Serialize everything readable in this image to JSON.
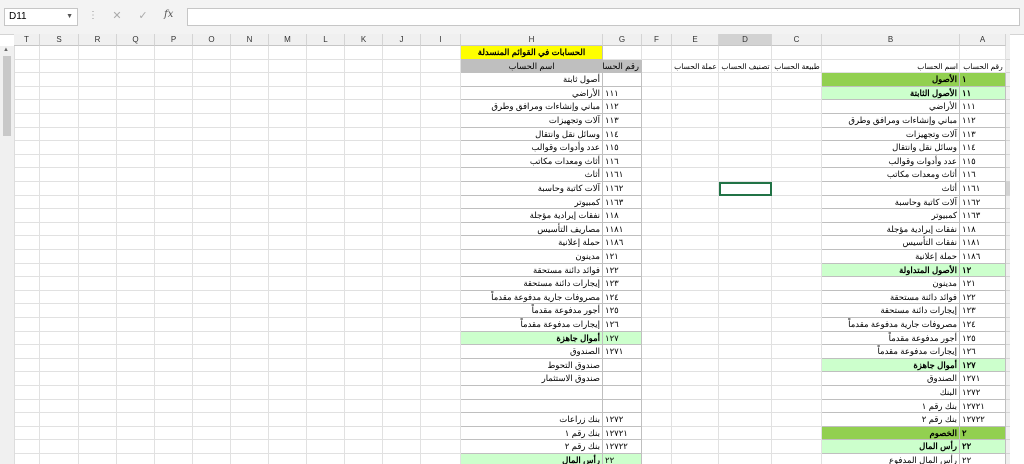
{
  "name_box": "D11",
  "formula_bar": {
    "cancel": "✕",
    "enter": "✓",
    "fx": "fx",
    "value": ""
  },
  "columns": [
    "T",
    "S",
    "R",
    "Q",
    "P",
    "O",
    "N",
    "M",
    "L",
    "K",
    "J",
    "I",
    "H",
    "G",
    "F",
    "E",
    "D",
    "C",
    "B",
    "A"
  ],
  "rows": [
    "1",
    "2",
    "3",
    "4",
    "5",
    "6",
    "7",
    "8",
    "9",
    "10",
    "11",
    "12",
    "13",
    "14",
    "15",
    "16",
    "17",
    "18",
    "19",
    "20",
    "21",
    "22",
    "23",
    "24",
    "25",
    "26",
    "27",
    "28",
    "29",
    "30",
    "31"
  ],
  "right_table": {
    "headers": {
      "a": "رقم الحساب",
      "b": "اسم الحساب",
      "c": "طبيعة الحساب",
      "d": "تصنيف الحساب",
      "e": "عملة الحساب"
    },
    "rows": [
      {
        "num": "١",
        "name": "الأصول",
        "style": "dgreen"
      },
      {
        "num": "١١",
        "name": "الأصول الثابتة",
        "style": "green"
      },
      {
        "num": "١١١",
        "name": "الأراضي",
        "style": ""
      },
      {
        "num": "١١٢",
        "name": "مباني وإنشاءات ومرافق وطرق",
        "style": ""
      },
      {
        "num": "١١٣",
        "name": "آلات وتجهيزات",
        "style": ""
      },
      {
        "num": "١١٤",
        "name": "وسائل نقل وانتقال",
        "style": ""
      },
      {
        "num": "١١٥",
        "name": "عدد وأدوات وقوالب",
        "style": ""
      },
      {
        "num": "١١٦",
        "name": "أثاث ومعدات مكاتب",
        "style": ""
      },
      {
        "num": "١١٦١",
        "name": "أثاث",
        "style": ""
      },
      {
        "num": "١١٦٢",
        "name": "آلات كاتبة وحاسبة",
        "style": ""
      },
      {
        "num": "١١٦٣",
        "name": "كمبيوتر",
        "style": ""
      },
      {
        "num": "١١٨",
        "name": "نفقات إيرادية مؤجلة",
        "style": ""
      },
      {
        "num": "١١٨١",
        "name": "نفقات التأسيس",
        "style": ""
      },
      {
        "num": "١١٨٦",
        "name": "حملة إعلانية",
        "style": ""
      },
      {
        "num": "١٢",
        "name": "الأصول المتداولة",
        "style": "green"
      },
      {
        "num": "١٢١",
        "name": "مدينون",
        "style": ""
      },
      {
        "num": "١٢٢",
        "name": "فوائد دائنة مستحقة",
        "style": ""
      },
      {
        "num": "١٢٣",
        "name": "إيجارات دائنة مستحقة",
        "style": ""
      },
      {
        "num": "١٢٤",
        "name": "مصروفات جارية مدفوعة مقدماً",
        "style": ""
      },
      {
        "num": "١٢٥",
        "name": "أجور مدفوعة مقدماً",
        "style": ""
      },
      {
        "num": "١٢٦",
        "name": "إيجارات مدفوعة مقدماً",
        "style": ""
      },
      {
        "num": "١٢٧",
        "name": "أموال جاهزة",
        "style": "green"
      },
      {
        "num": "١٢٧١",
        "name": "الصندوق",
        "style": ""
      },
      {
        "num": "١٢٧٢",
        "name": "البنك",
        "style": ""
      },
      {
        "num": "١٢٧٢١",
        "name": "بنك رقم ١",
        "style": ""
      },
      {
        "num": "١٢٧٢٢",
        "name": "بنك رقم ٢",
        "style": ""
      },
      {
        "num": "٢",
        "name": "الخصوم",
        "style": "dgreen"
      },
      {
        "num": "٢٢",
        "name": "رأس المال",
        "style": "green"
      },
      {
        "num": "٢٢",
        "name": "رأس المال المدفوع",
        "style": ""
      }
    ]
  },
  "left_table": {
    "title": "الحسابات في القوائم المنسدلة",
    "headers": {
      "g": "رقم الحساب",
      "h": "اسم الحساب"
    },
    "rows": [
      {
        "num": "",
        "name": "أصول ثابتة",
        "style": ""
      },
      {
        "num": "١١١",
        "name": "الأراضي",
        "style": ""
      },
      {
        "num": "١١٢",
        "name": "مباني وإنشاءات ومرافق وطرق",
        "style": ""
      },
      {
        "num": "١١٣",
        "name": "آلات وتجهيزات",
        "style": ""
      },
      {
        "num": "١١٤",
        "name": "وسائل نقل وانتقال",
        "style": ""
      },
      {
        "num": "١١٥",
        "name": "عدد وأدوات وقوالب",
        "style": ""
      },
      {
        "num": "١١٦",
        "name": "أثاث ومعدات مكاتب",
        "style": ""
      },
      {
        "num": "١١٦١",
        "name": "أثاث",
        "style": ""
      },
      {
        "num": "١١٦٢",
        "name": "آلات كاتبة وحاسبة",
        "style": ""
      },
      {
        "num": "١١٦٣",
        "name": "كمبيوتر",
        "style": ""
      },
      {
        "num": "١١٨",
        "name": "نفقات إيرادية مؤجلة",
        "style": ""
      },
      {
        "num": "١١٨١",
        "name": "مصاريف التأسيس",
        "style": ""
      },
      {
        "num": "١١٨٦",
        "name": "حملة إعلانية",
        "style": ""
      },
      {
        "num": "١٢١",
        "name": "مدينون",
        "style": ""
      },
      {
        "num": "١٢٢",
        "name": "فوائد دائنة مستحقة",
        "style": ""
      },
      {
        "num": "١٢٣",
        "name": "إيجارات دائنة مستحقة",
        "style": ""
      },
      {
        "num": "١٢٤",
        "name": "مصروفات جارية مدفوعة مقدماً",
        "style": ""
      },
      {
        "num": "١٢٥",
        "name": "أجور مدفوعة مقدماً",
        "style": ""
      },
      {
        "num": "١٢٦",
        "name": "إيجارات مدفوعة مقدماً",
        "style": ""
      },
      {
        "num": "١٢٧",
        "name": "أموال جاهزة",
        "style": "green"
      },
      {
        "num": "١٢٧١",
        "name": "الصندوق",
        "style": ""
      },
      {
        "num": "",
        "name": "صندوق التحوط",
        "style": ""
      },
      {
        "num": "",
        "name": "صندوق الاستثمار",
        "style": ""
      },
      {
        "num": "",
        "name": "",
        "style": ""
      },
      {
        "num": "",
        "name": "",
        "style": ""
      },
      {
        "num": "١٢٧٢",
        "name": "بنك زراعات",
        "style": ""
      },
      {
        "num": "١٢٧٢١",
        "name": "بنك رقم ١",
        "style": ""
      },
      {
        "num": "١٢٧٢٢",
        "name": "بنك رقم ٢",
        "style": ""
      },
      {
        "num": "٢٢",
        "name": "رأس المال",
        "style": "green"
      }
    ]
  }
}
